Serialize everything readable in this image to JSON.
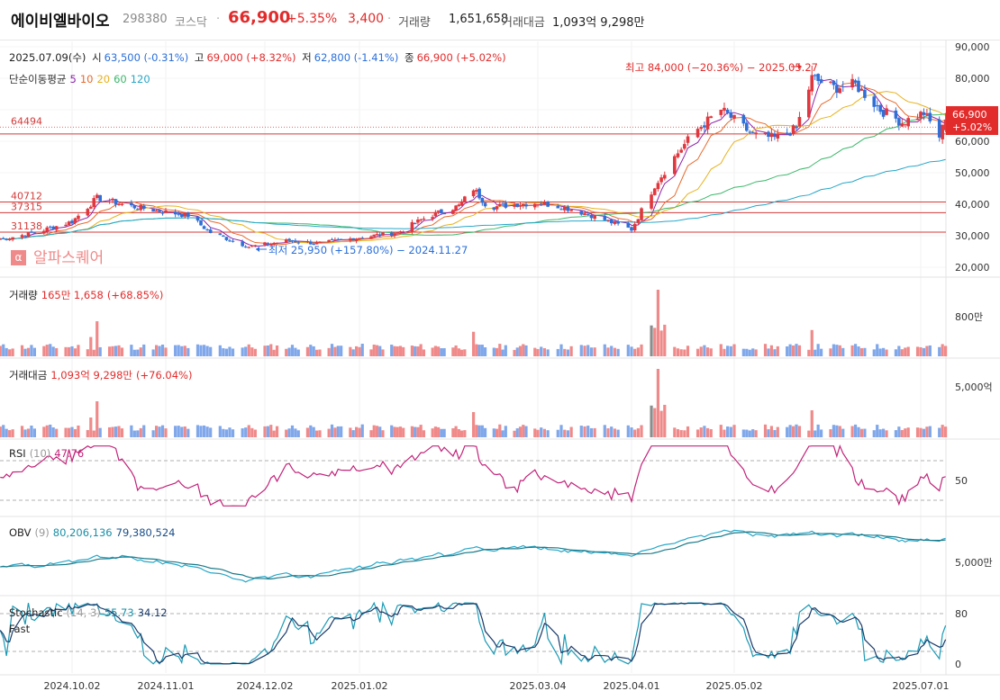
{
  "header": {
    "name": "에이비엘바이오",
    "code": "298380",
    "market": "코스닥",
    "dot": "·",
    "price": "66,900",
    "change_pct": "+5.35%",
    "change_abs": "3,400",
    "volume_label": "거래량",
    "volume_value": "1,651,658",
    "amount_label": "거래대금",
    "amount_value": "1,093억 9,298만"
  },
  "info": {
    "date": "2025.07.09(수)",
    "open_label": "시",
    "open": "63,500 (-0.31%)",
    "high_label": "고",
    "high": "69,000 (+8.32%)",
    "low_label": "저",
    "low": "62,800 (-1.41%)",
    "close_label": "종",
    "close": "66,900 (+5.02%)"
  },
  "ma": {
    "label": "단순이동평균",
    "periods": [
      "5",
      "10",
      "20",
      "60",
      "120"
    ],
    "colors": [
      "#8e24aa",
      "#e86a2e",
      "#e8b21c",
      "#3cb86b",
      "#27a7c9"
    ]
  },
  "annotations": {
    "max": "최고 84,000 (−20.36%) − 2025.05.27",
    "min": "최저 25,950 (+157.80%) − 2024.11.27"
  },
  "levels": [
    "64494",
    "40712",
    "37315",
    "31138"
  ],
  "price_tag": {
    "price": "66,900",
    "pct": "+5.02%"
  },
  "watermark": {
    "icon": "α",
    "text": "알파스퀘어"
  },
  "volume_panel": {
    "label": "거래량",
    "value": "165만 1,658",
    "pct": "(+68.85%)",
    "axis": "800만"
  },
  "amount_panel": {
    "label": "거래대금",
    "value": "1,093억 9,298만",
    "pct": "(+76.04%)",
    "axis": "5,000억"
  },
  "rsi_panel": {
    "label": "RSI",
    "param": "(10)",
    "value": "47.76",
    "axis": "50"
  },
  "obv_panel": {
    "label": "OBV",
    "param": "(9)",
    "v1": "80,206,136",
    "v2": "79,380,524",
    "axis": "5,000만"
  },
  "stoch_panel": {
    "label": "Stochastic",
    "label2": "Fast",
    "param": "(14, 3)",
    "v1": "55.73",
    "v2": "34.12",
    "axis_high": "80",
    "axis_low": "0"
  },
  "chart_data": {
    "type": "candlestick",
    "title": "에이비엘바이오",
    "x_ticks": [
      "2024.10.02",
      "2024.11.01",
      "2024.12.02",
      "2025.01.02",
      "2025.03.04",
      "2025.04.01",
      "2025.05.02",
      "2025.07.01"
    ],
    "price_axis_ticks": [
      "90,000",
      "80,000",
      "70,000",
      "60,000",
      "50,000",
      "40,000",
      "30,000",
      "20,000"
    ],
    "price_range": [
      20000,
      90000
    ],
    "anchors_close": [
      [
        "2024-09-10",
        29000
      ],
      [
        "2024-09-20",
        31000
      ],
      [
        "2024-10-02",
        34500
      ],
      [
        "2024-10-10",
        42000
      ],
      [
        "2024-10-20",
        39500
      ],
      [
        "2024-11-01",
        37500
      ],
      [
        "2024-11-08",
        36500
      ],
      [
        "2024-11-15",
        31000
      ],
      [
        "2024-11-27",
        26500
      ],
      [
        "2024-12-10",
        28500
      ],
      [
        "2024-12-20",
        27500
      ],
      [
        "2025-01-02",
        29500
      ],
      [
        "2025-01-15",
        31000
      ],
      [
        "2025-01-25",
        36000
      ],
      [
        "2025-02-05",
        39500
      ],
      [
        "2025-02-10",
        45000
      ],
      [
        "2025-02-15",
        39000
      ],
      [
        "2025-02-25",
        40000
      ],
      [
        "2025-03-04",
        40500
      ],
      [
        "2025-03-12",
        39000
      ],
      [
        "2025-03-20",
        36500
      ],
      [
        "2025-04-01",
        32000
      ],
      [
        "2025-04-08",
        46000
      ],
      [
        "2025-04-14",
        55000
      ],
      [
        "2025-04-20",
        63000
      ],
      [
        "2025-04-28",
        70000
      ],
      [
        "2025-05-08",
        62000
      ],
      [
        "2025-05-15",
        61000
      ],
      [
        "2025-05-22",
        64000
      ],
      [
        "2025-05-27",
        80000
      ],
      [
        "2025-06-03",
        77000
      ],
      [
        "2025-06-10",
        78000
      ],
      [
        "2025-06-18",
        70000
      ],
      [
        "2025-06-25",
        66000
      ],
      [
        "2025-07-02",
        69000
      ],
      [
        "2025-07-07",
        61500
      ],
      [
        "2025-07-09",
        66900
      ]
    ],
    "high": 84000,
    "high_date": "2025-05-27",
    "low": 25950,
    "low_date": "2024-11-27",
    "last": {
      "date": "2025-07-09",
      "open": 63500,
      "high": 69000,
      "low": 62800,
      "close": 66900
    },
    "h_lines": [
      64494,
      40712,
      37315,
      31138
    ]
  }
}
